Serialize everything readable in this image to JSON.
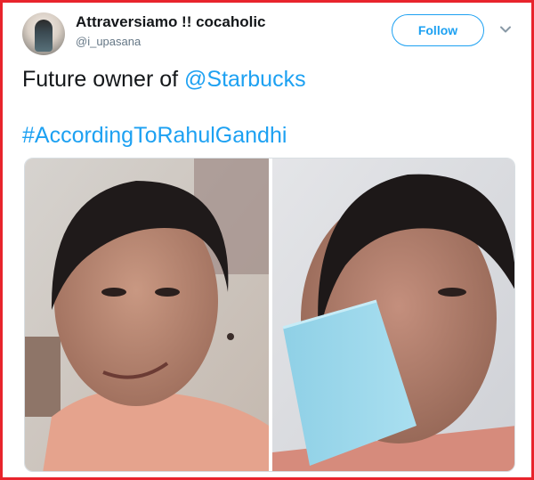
{
  "tweet": {
    "author": {
      "display_name": "Attraversiamo !! cocaholic",
      "handle": "@i_upasana"
    },
    "follow_label": "Follow",
    "text_prefix": "Future owner of ",
    "mention": "@Starbucks",
    "hashtag": "#AccordingToRahulGandhi"
  },
  "colors": {
    "link_blue": "#1da1f2",
    "frame_red": "#e8242c"
  },
  "icons": {
    "more": "chevron-down-icon"
  }
}
